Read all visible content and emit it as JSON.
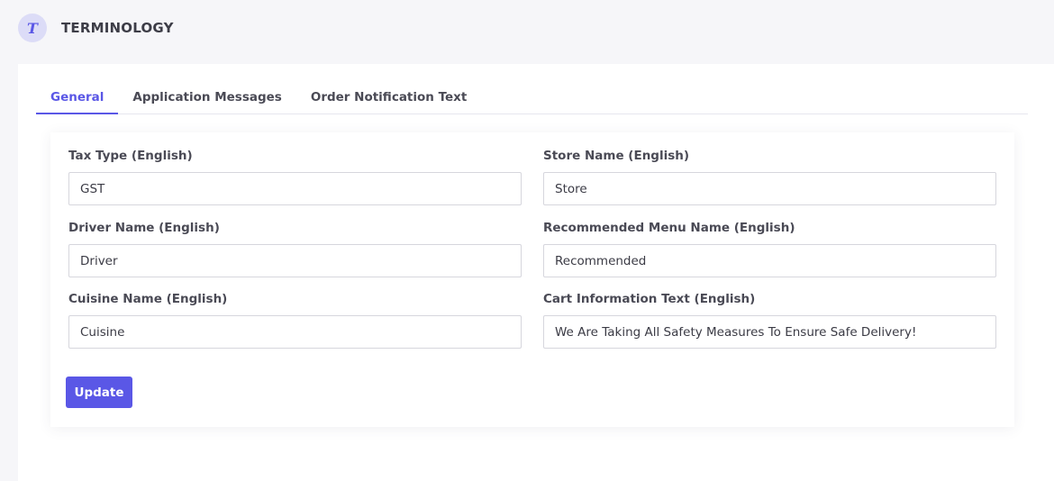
{
  "header": {
    "avatar_letter": "T",
    "title": "TERMINOLOGY"
  },
  "tabs": [
    {
      "label": "General",
      "active": true
    },
    {
      "label": "Application Messages",
      "active": false
    },
    {
      "label": "Order Notification Text",
      "active": false
    }
  ],
  "form": {
    "fields": [
      {
        "label": "Tax Type (English)",
        "value": "GST"
      },
      {
        "label": "Store Name (English)",
        "value": "Store"
      },
      {
        "label": "Driver Name (English)",
        "value": "Driver"
      },
      {
        "label": "Recommended Menu Name (English)",
        "value": "Recommended"
      },
      {
        "label": "Cuisine Name (English)",
        "value": "Cuisine"
      },
      {
        "label": "Cart Information Text (English)",
        "value": "We Are Taking All Safety Measures To Ensure Safe Delivery!"
      }
    ],
    "update_label": "Update"
  },
  "colors": {
    "accent": "#5a57e6",
    "background": "#f6f6f9",
    "avatar_bg": "#dcdcf7"
  }
}
